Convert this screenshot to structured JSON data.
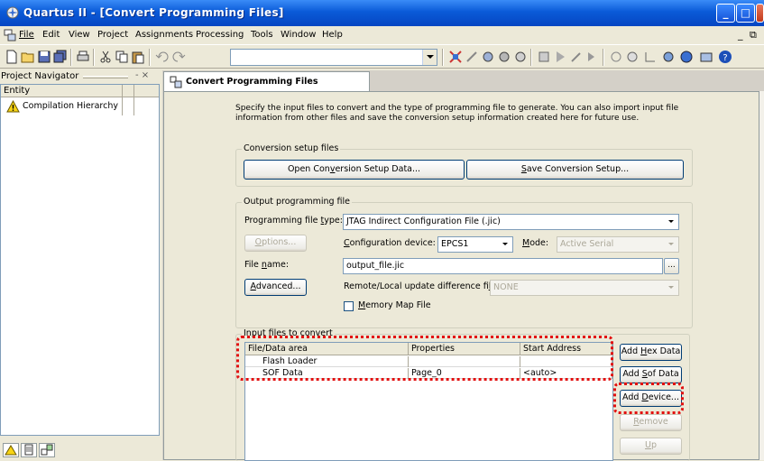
{
  "window": {
    "title": "Quartus II - [Convert Programming Files]",
    "controls": {
      "minimize": "_",
      "maximize": "□",
      "close": "X"
    }
  },
  "menu": {
    "items": [
      {
        "label": "File",
        "mnemonic_index": 0
      },
      {
        "label": "Edit",
        "mnemonic_index": 0
      },
      {
        "label": "View",
        "mnemonic_index": 0
      },
      {
        "label": "Project",
        "mnemonic_index": 0
      },
      {
        "label": "Assignments",
        "mnemonic_index": 0
      },
      {
        "label": "Processing",
        "mnemonic_index": 0
      },
      {
        "label": "Tools",
        "mnemonic_index": 0
      },
      {
        "label": "Window",
        "mnemonic_index": 0
      },
      {
        "label": "Help",
        "mnemonic_index": 0
      }
    ],
    "mdi_min": "_",
    "mdi_restore": "⧉"
  },
  "navigator": {
    "title": "Project Navigator",
    "pin": "- ×",
    "column": "Entity",
    "item": "Compilation Hierarchy"
  },
  "document_tab": "Convert Programming Files",
  "intro": "Specify the input files to convert and the type of programming file to generate. You can also import input file information from other files and save the conversion setup information created here for future use.",
  "conversion_setup": {
    "group_title": "Conversion setup files",
    "open_pre": "Open Con",
    "open_ul": "v",
    "open_post": "ersion Setup Data...",
    "save_ul": "S",
    "save_post": "ave Conversion Setup..."
  },
  "output": {
    "group_title": "Output programming file",
    "file_type_pre": "Programming file ",
    "file_type_ul": "t",
    "file_type_post": "ype:",
    "file_type_value": "JTAG Indirect Configuration File (.jic)",
    "options_ul": "O",
    "options_post": "ptions...",
    "config_device_ul": "C",
    "config_device_post": "onfiguration device:",
    "config_device_value": "EPCS1",
    "mode_ul": "M",
    "mode_post": "ode:",
    "mode_value": "Active Serial",
    "file_name_pre": "File ",
    "file_name_ul": "n",
    "file_name_post": "ame:",
    "file_name_value": "output_file.jic",
    "browse": "...",
    "advanced_ul": "A",
    "advanced_post": "dvanced...",
    "remote_label_pre": "Remote/Local update difference fi",
    "remote_label_ul": "l",
    "remote_label_post": "e:",
    "remote_value": "NONE",
    "memory_map_ul": "M",
    "memory_map_post": "emory Map File"
  },
  "input": {
    "group_title": "Input files to convert",
    "columns": [
      "File/Data area",
      "Properties",
      "Start Address"
    ],
    "rows": [
      {
        "file": "Flash Loader",
        "properties": "",
        "start": ""
      },
      {
        "file": "SOF Data",
        "properties": "Page_0",
        "start": "<auto>"
      }
    ],
    "buttons": {
      "add_hex_pre": "Add ",
      "add_hex_ul": "H",
      "add_hex_post": "ex Data",
      "add_sof_pre": "Add ",
      "add_sof_ul": "S",
      "add_sof_post": "of Data",
      "add_device_pre": "Add ",
      "add_device_ul": "D",
      "add_device_post": "evice...",
      "remove_ul": "R",
      "remove_post": "emove",
      "up_ul": "U",
      "up_post": "p"
    }
  },
  "colors": {
    "titlebar": "#0a5ad8",
    "highlight_dash": "#e21010",
    "window_bg": "#ece9d8"
  }
}
